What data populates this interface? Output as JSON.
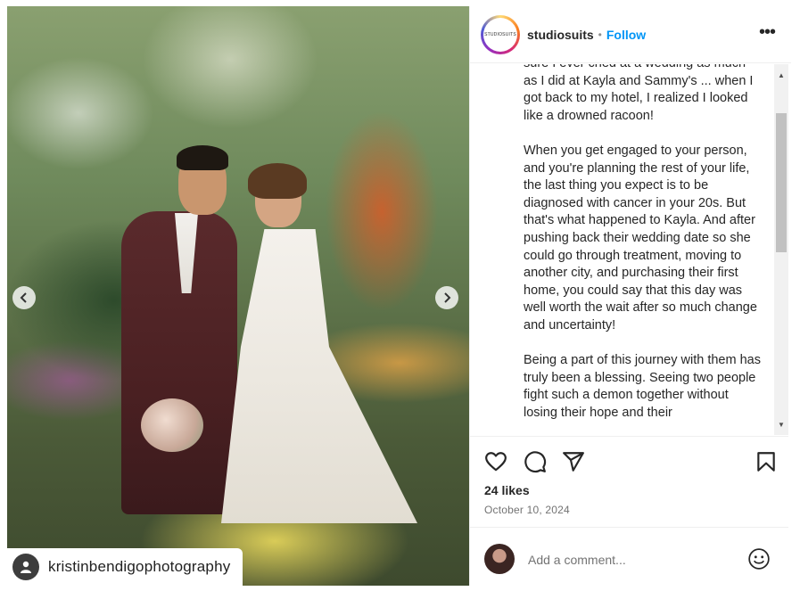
{
  "post": {
    "photo_tag": "kristinbendigophotography"
  },
  "header": {
    "avatar_text": "STUDIOSUITS",
    "username": "studiosuits",
    "separator": "•",
    "follow_label": "Follow",
    "more_label": "•••"
  },
  "caption": {
    "paragraphs": [
      "sure I ever cried at a wedding as much as I did at Kayla and Sammy's ... when I got back to my hotel, I realized I looked like a drowned racoon!",
      "When you get engaged to your person, and you're planning the rest of your life, the last thing you expect is to be diagnosed with cancer in your 20s. But that's what happened to Kayla. And after pushing back their wedding date so she could go through treatment, moving to another city, and purchasing their first home, you could say that this day was well worth the wait after so much change and uncertainty!",
      "Being a part of this journey with them has truly been a blessing. Seeing two people fight such a demon together without losing their hope and their"
    ]
  },
  "actions": {
    "likes": "24 likes",
    "date": "October 10, 2024"
  },
  "comment": {
    "placeholder": "Add a comment..."
  },
  "icons": {
    "like": "heart-icon",
    "comment": "speech-bubble-icon",
    "share": "paper-plane-icon",
    "save": "bookmark-icon",
    "emoji": "smiley-icon",
    "prev": "chevron-left-icon",
    "next": "chevron-right-icon"
  }
}
